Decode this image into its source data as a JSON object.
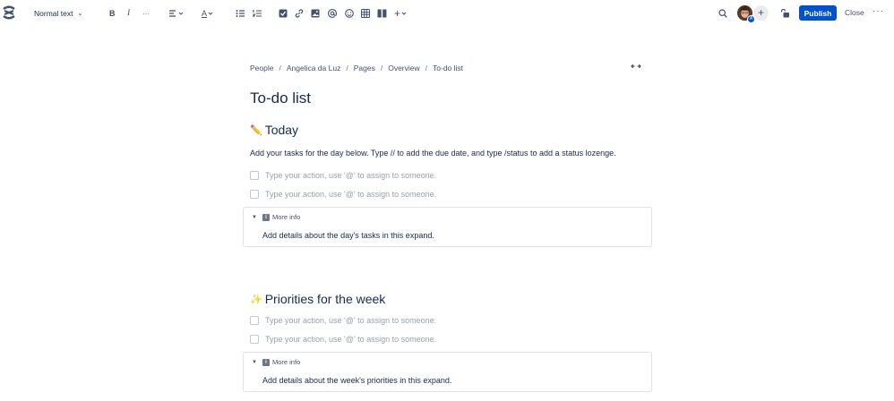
{
  "toolbar": {
    "text_style": "Normal text",
    "bold": "B",
    "italic": "I",
    "more": "···",
    "text_color": "A",
    "insert": "+",
    "publish_label": "Publish",
    "close_label": "Close",
    "overflow": "···",
    "avatar_badge": "A",
    "add_collaborator": "+"
  },
  "breadcrumb": [
    "People",
    "Angelica da Luz",
    "Pages",
    "Overview",
    "To-do list"
  ],
  "page": {
    "title": "To-do list",
    "sections": [
      {
        "emoji": "✏️",
        "heading": "Today",
        "paragraph": "Add your tasks for the day below. Type // to add the due date, and type /status to add a status lozenge.",
        "tasks": [
          "Type your action, use '@' to assign to someone.",
          "Type your action, use '@' to assign to someone."
        ],
        "expand": {
          "title": "More info",
          "info_icon": "i",
          "body": "Add details about the day's tasks in this expand."
        }
      },
      {
        "emoji": "✨",
        "heading": "Priorities for the week",
        "tasks": [
          "Type your action, use '@' to assign to someone.",
          "Type your action, use '@' to assign to someone."
        ],
        "expand": {
          "title": "More info",
          "info_icon": "i",
          "body": "Add details about the week's priorities in this expand."
        }
      }
    ]
  },
  "colors": {
    "primary": "#0052cc",
    "text": "#172b4d",
    "subtle": "#42526e",
    "placeholder": "#97a0af",
    "border": "#dfe1e6"
  }
}
